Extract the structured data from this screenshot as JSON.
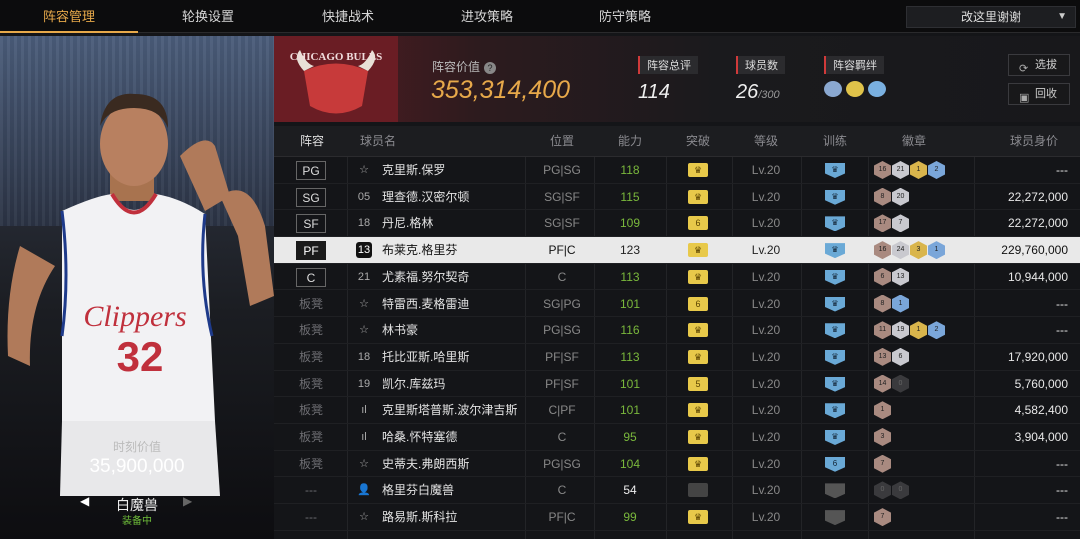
{
  "nav": {
    "tabs": [
      "阵容管理",
      "轮换设置",
      "快捷战术",
      "进攻策略",
      "防守策略"
    ],
    "active_tab": 0,
    "dropdown_label": "改这里谢谢"
  },
  "left_panel": {
    "jersey_team": "Clippers",
    "jersey_number": "32",
    "value_label": "时刻价值",
    "value": "35,900,000",
    "player_name": "白魔兽",
    "status": "装备中"
  },
  "summary": {
    "team_logo_text": "CHICAGO BULLS",
    "lineup_value_label": "阵容价值",
    "lineup_value": "353,314,400",
    "rating_label": "阵容总评",
    "rating": "114",
    "player_count_label": "球员数",
    "player_count": "26",
    "player_count_max": "/300",
    "bonds_label": "阵容羁绊",
    "bond_colors": [
      "#8aa8d0",
      "#e0c34a",
      "#7ab0e0"
    ],
    "select_button": "选拔",
    "recycle_button": "回收"
  },
  "table": {
    "headers": [
      "阵容",
      "球员名",
      "位置",
      "能力",
      "突破",
      "等级",
      "训练",
      "徽章",
      "球员身价"
    ],
    "rows": [
      {
        "slot": "PG",
        "starter": true,
        "num": "☆",
        "name": "克里斯.保罗",
        "pos": "PG|SG",
        "ability": "118",
        "ability_color": "green",
        "breakthrough": "♛",
        "level": "Lv.20",
        "train": "♛",
        "badges": [
          [
            "bronze",
            "16"
          ],
          [
            "silver",
            "21"
          ],
          [
            "gold",
            "1"
          ],
          [
            "blue",
            "2"
          ]
        ],
        "salary": "---"
      },
      {
        "slot": "SG",
        "starter": true,
        "num": "05",
        "name": "理查德.汉密尔顿",
        "pos": "SG|SF",
        "ability": "115",
        "ability_color": "green",
        "breakthrough": "♛",
        "level": "Lv.20",
        "train": "♛",
        "badges": [
          [
            "bronze",
            "8"
          ],
          [
            "silver",
            "20"
          ]
        ],
        "salary": "22,272,000"
      },
      {
        "slot": "SF",
        "starter": true,
        "num": "18",
        "name": "丹尼.格林",
        "pos": "SG|SF",
        "ability": "109",
        "ability_color": "green",
        "breakthrough": "6",
        "level": "Lv.20",
        "train": "♛",
        "badges": [
          [
            "bronze",
            "17"
          ],
          [
            "silver",
            "7"
          ]
        ],
        "salary": "22,272,000"
      },
      {
        "slot": "PF",
        "starter": true,
        "selected": true,
        "num": "13",
        "name": "布莱克.格里芬",
        "pos": "PF|C",
        "ability": "123",
        "ability_color": "white",
        "breakthrough": "♛",
        "level": "Lv.20",
        "train": "♛",
        "badges": [
          [
            "bronze",
            "16"
          ],
          [
            "silver",
            "24"
          ],
          [
            "gold",
            "3"
          ],
          [
            "blue",
            "1"
          ]
        ],
        "salary": "229,760,000"
      },
      {
        "slot": "C",
        "starter": true,
        "num": "21",
        "name": "尤素福.努尔契奇",
        "pos": "C",
        "ability": "113",
        "ability_color": "green",
        "breakthrough": "♛",
        "level": "Lv.20",
        "train": "♛",
        "badges": [
          [
            "bronze",
            "6"
          ],
          [
            "silver",
            "13"
          ]
        ],
        "salary": "10,944,000"
      },
      {
        "slot": "板凳",
        "starter": false,
        "num": "☆",
        "name": "特雷西.麦格雷迪",
        "pos": "SG|PG",
        "ability": "101",
        "ability_color": "green",
        "breakthrough": "6",
        "level": "Lv.20",
        "train": "♛",
        "badges": [
          [
            "bronze",
            "8"
          ],
          [
            "blue",
            "1"
          ]
        ],
        "salary": "---"
      },
      {
        "slot": "板凳",
        "starter": false,
        "num": "☆",
        "name": "林书豪",
        "pos": "PG|SG",
        "ability": "116",
        "ability_color": "green",
        "breakthrough": "♛",
        "level": "Lv.20",
        "train": "♛",
        "badges": [
          [
            "bronze",
            "11"
          ],
          [
            "silver",
            "19"
          ],
          [
            "gold",
            "1"
          ],
          [
            "blue",
            "2"
          ]
        ],
        "salary": "---"
      },
      {
        "slot": "板凳",
        "starter": false,
        "num": "18",
        "name": "托比亚斯.哈里斯",
        "pos": "PF|SF",
        "ability": "113",
        "ability_color": "green",
        "breakthrough": "♛",
        "level": "Lv.20",
        "train": "♛",
        "badges": [
          [
            "bronze",
            "13"
          ],
          [
            "silver",
            "6"
          ]
        ],
        "salary": "17,920,000"
      },
      {
        "slot": "板凳",
        "starter": false,
        "num": "19",
        "name": "凯尔.库兹玛",
        "pos": "PF|SF",
        "ability": "101",
        "ability_color": "green",
        "breakthrough": "5",
        "level": "Lv.20",
        "train": "♛",
        "badges": [
          [
            "bronze",
            "14"
          ],
          [
            "dark",
            "0"
          ]
        ],
        "salary": "5,760,000"
      },
      {
        "slot": "板凳",
        "starter": false,
        "num": "ıl",
        "name": "克里斯塔普斯.波尔津吉斯",
        "pos": "C|PF",
        "ability": "101",
        "ability_color": "green",
        "breakthrough": "♛",
        "level": "Lv.20",
        "train": "♛",
        "badges": [
          [
            "bronze",
            "1"
          ]
        ],
        "salary": "4,582,400"
      },
      {
        "slot": "板凳",
        "starter": false,
        "num": "ıl",
        "name": "哈桑.怀特塞德",
        "pos": "C",
        "ability": "95",
        "ability_color": "green",
        "breakthrough": "♛",
        "level": "Lv.20",
        "train": "♛",
        "badges": [
          [
            "bronze",
            "3"
          ]
        ],
        "salary": "3,904,000"
      },
      {
        "slot": "板凳",
        "starter": false,
        "num": "☆",
        "name": "史蒂夫.弗朗西斯",
        "pos": "PG|SG",
        "ability": "104",
        "ability_color": "green",
        "breakthrough": "♛",
        "level": "Lv.20",
        "train": "6",
        "badges": [
          [
            "bronze",
            "7"
          ]
        ],
        "salary": "---"
      },
      {
        "slot": "---",
        "starter": false,
        "num": "👤",
        "name": "格里芬白魔兽",
        "pos": "C",
        "ability": "54",
        "ability_color": "white",
        "breakthrough": "",
        "level": "Lv.20",
        "train": "",
        "badges": [
          [
            "dark",
            "0"
          ],
          [
            "dark",
            "0"
          ]
        ],
        "salary": "---"
      },
      {
        "slot": "---",
        "starter": false,
        "num": "☆",
        "name": "路易斯.斯科拉",
        "pos": "PF|C",
        "ability": "99",
        "ability_color": "green",
        "breakthrough": "♛",
        "level": "Lv.20",
        "train": "",
        "badges": [
          [
            "bronze",
            "7"
          ]
        ],
        "salary": "---"
      }
    ]
  }
}
